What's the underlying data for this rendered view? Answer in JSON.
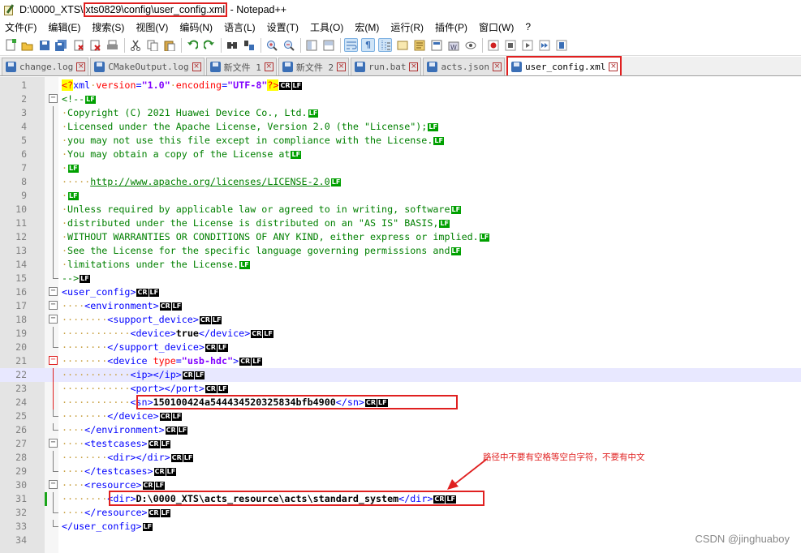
{
  "window": {
    "title_prefix": "D:\\0000_XTS\\",
    "title_path": "xts0829\\config\\user_config.xml",
    "title_suffix": " - Notepad++"
  },
  "menu": [
    "文件(F)",
    "编辑(E)",
    "搜索(S)",
    "视图(V)",
    "编码(N)",
    "语言(L)",
    "设置(T)",
    "工具(O)",
    "宏(M)",
    "运行(R)",
    "插件(P)",
    "窗口(W)",
    "?"
  ],
  "tabs": [
    {
      "label": "change.log"
    },
    {
      "label": "CMakeOutput.log"
    },
    {
      "label": "新文件 1"
    },
    {
      "label": "新文件 2"
    },
    {
      "label": "run.bat"
    },
    {
      "label": "acts.json"
    },
    {
      "label": "user_config.xml"
    }
  ],
  "line_numbers": [
    "1",
    "2",
    "3",
    "4",
    "5",
    "6",
    "7",
    "8",
    "9",
    "10",
    "11",
    "12",
    "13",
    "14",
    "15",
    "16",
    "17",
    "18",
    "19",
    "20",
    "21",
    "22",
    "23",
    "24",
    "25",
    "26",
    "27",
    "28",
    "29",
    "30",
    "31",
    "32",
    "33",
    "34"
  ],
  "code": {
    "l1": {
      "pi_open": "<?",
      "tagname": "xml",
      "a1": "version",
      "v1": "\"1.0\"",
      "a2": "encoding",
      "v2": "\"UTF-8\"",
      "pi_close": "?>"
    },
    "l2": "<!--",
    "l3": "Copyright (C) 2021 Huawei Device Co., Ltd.",
    "l4": "Licensed under the Apache License, Version 2.0 (the \"License\");",
    "l5": "you may not use this file except in compliance with the License.",
    "l6": "You may obtain a copy of the License at",
    "l8": "http://www.apache.org/licenses/LICENSE-2.0",
    "l10": "Unless required by applicable law or agreed to in writing, software",
    "l11": "distributed under the License is distributed on an \"AS IS\" BASIS,",
    "l12": "WITHOUT WARRANTIES OR CONDITIONS OF ANY KIND, either express or implied.",
    "l13": "See the License for the specific language governing permissions and",
    "l14": "limitations under the License.",
    "l15": "-->",
    "l16": "<user_config>",
    "l17": "<environment>",
    "l18": "<support_device>",
    "l19_open": "<device>",
    "l19_text": "true",
    "l19_close": "</device>",
    "l20": "</support_device>",
    "l21_open": "<device ",
    "l21_attr": "type",
    "l21_eq": "=",
    "l21_val": "\"usb-hdc\"",
    "l21_close": ">",
    "l22": "<ip></ip>",
    "l23": "<port></port>",
    "l24_open": "<sn>",
    "l24_text": "150100424a544434520325834bfb4900",
    "l24_close": "</sn>",
    "l25": "</device>",
    "l26": "</environment>",
    "l27": "<testcases>",
    "l28": "<dir></dir>",
    "l29": "</testcases>",
    "l30": "<resource>",
    "l31_open": "<dir>",
    "l31_text": "D:\\0000_XTS\\acts_resource\\acts\\standard_system",
    "l31_close": "</dir>",
    "l32": "</resource>",
    "l33": "</user_config>"
  },
  "eol": {
    "cr": "CR",
    "lf": "LF"
  },
  "annotation": "路径中不要有空格等空白字符，不要有中文",
  "watermark": "CSDN @jinghuaboy",
  "colors": {
    "annotation": "#e02020",
    "tag": "#0000ff",
    "attribute": "#ff0000",
    "comment": "#008000"
  }
}
